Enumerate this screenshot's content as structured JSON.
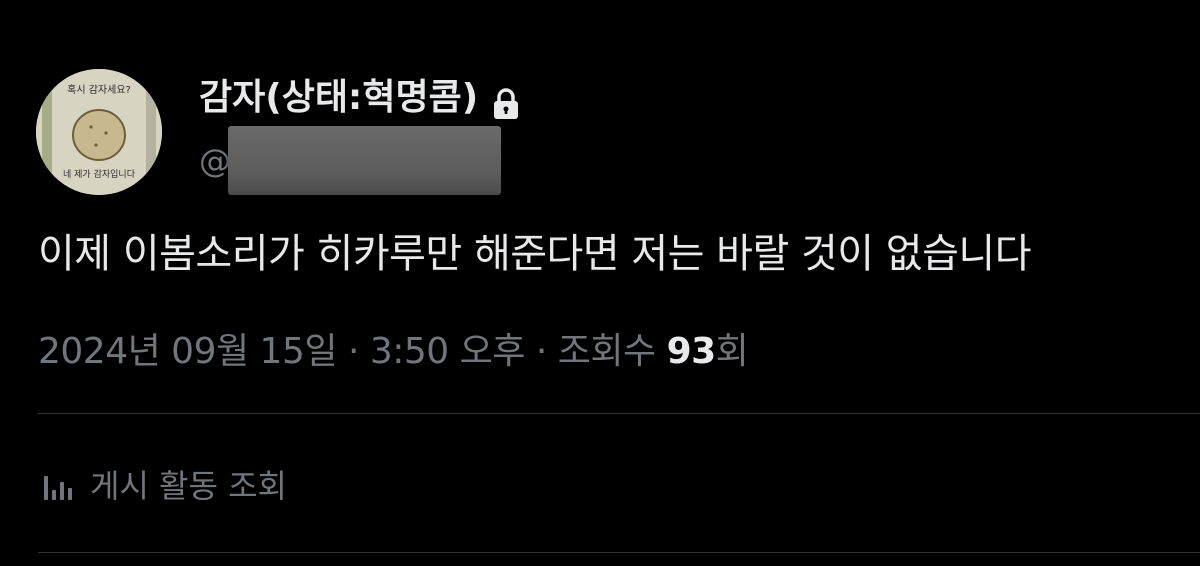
{
  "user": {
    "display_name": "감자(상태:혁명콤)",
    "handle_prefix": "@",
    "avatar": {
      "text_top": "혹시 감자세요?",
      "text_bottom": "네 제가 감자입니다"
    }
  },
  "tweet": {
    "text": "이제 이봄소리가 히카루만 해준다면 저는 바랄 것이 없습니다"
  },
  "meta": {
    "date": "2024년 09월 15일",
    "separator": "·",
    "time": "3:50 오후",
    "views_label": "조회수",
    "views_count": "93",
    "views_unit": "회"
  },
  "actions": {
    "view_activity_label": "게시 활동 조회"
  },
  "colors": {
    "background": "#000000",
    "primary_text": "#e7e9ea",
    "secondary_text": "#71767b",
    "divider": "#2f3336"
  },
  "icons": {
    "lock": "lock-icon",
    "activity": "bar-chart-icon"
  }
}
